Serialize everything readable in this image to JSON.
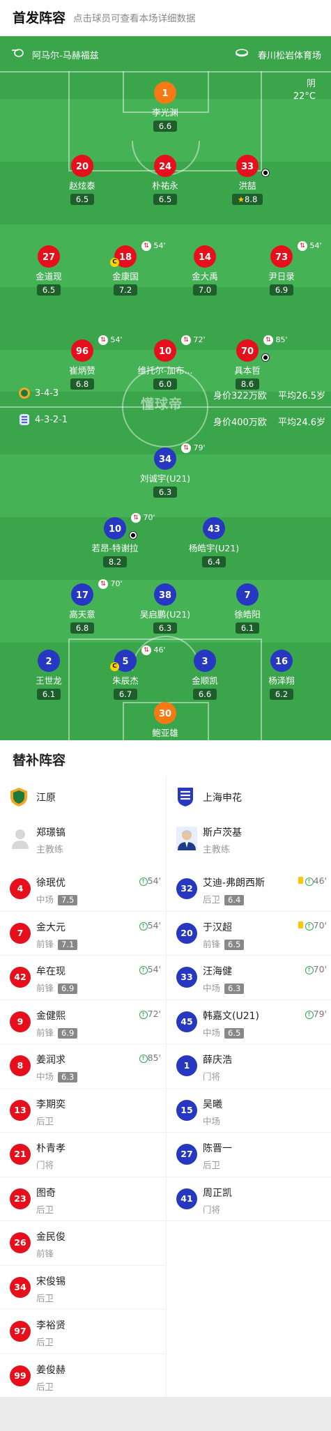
{
  "header": {
    "title": "首发阵容",
    "subtitle": "点击球员可查看本场详细数据"
  },
  "match": {
    "home_team": "阿马尔-马赫福兹",
    "venue": "春川松岩体育场",
    "weather": "阴",
    "temperature": "22°C",
    "watermark": "懂球帝"
  },
  "home_form": {
    "formation": "3-4-3",
    "value": "身价322万欧",
    "age": "平均26.5岁"
  },
  "away_form": {
    "formation": "4-3-2-1",
    "value": "身价400万欧",
    "age": "平均24.6岁"
  },
  "home_players": [
    {
      "num": "1",
      "name": "李光渊",
      "rating": "6.6",
      "color": "orange"
    },
    {
      "num": "20",
      "name": "赵炫泰",
      "rating": "6.5",
      "color": "red"
    },
    {
      "num": "24",
      "name": "朴祐永",
      "rating": "6.5",
      "color": "red"
    },
    {
      "num": "33",
      "name": "洪喆",
      "rating": "8.8",
      "color": "red",
      "star": true,
      "ball": true
    },
    {
      "num": "27",
      "name": "金道现",
      "rating": "6.5",
      "color": "red"
    },
    {
      "num": "18",
      "name": "金康国",
      "rating": "7.2",
      "color": "red",
      "sub": "54'",
      "captain": true
    },
    {
      "num": "14",
      "name": "金大禹",
      "rating": "7.0",
      "color": "red"
    },
    {
      "num": "73",
      "name": "尹日录",
      "rating": "6.9",
      "color": "red",
      "sub": "54'"
    },
    {
      "num": "96",
      "name": "崔炳赞",
      "rating": "6.8",
      "color": "red",
      "sub": "54'"
    },
    {
      "num": "10",
      "name": "维托尔-加布...",
      "rating": "6.0",
      "color": "red",
      "sub": "72'"
    },
    {
      "num": "70",
      "name": "具本哲",
      "rating": "8.6",
      "color": "red",
      "sub": "85'",
      "ball": true
    }
  ],
  "away_players": [
    {
      "num": "34",
      "name": "刘诚宇(U21)",
      "rating": "6.3",
      "color": "blue",
      "sub": "79'"
    },
    {
      "num": "10",
      "name": "若昂-特谢拉",
      "rating": "8.2",
      "color": "blue",
      "sub": "70'",
      "ball": true
    },
    {
      "num": "43",
      "name": "杨皓宇(U21)",
      "rating": "6.4",
      "color": "blue"
    },
    {
      "num": "17",
      "name": "高天意",
      "rating": "6.8",
      "color": "blue",
      "sub": "70'"
    },
    {
      "num": "38",
      "name": "吴启鹏(U21)",
      "rating": "6.3",
      "color": "blue"
    },
    {
      "num": "7",
      "name": "徐皓阳",
      "rating": "6.1",
      "color": "blue"
    },
    {
      "num": "2",
      "name": "王世龙",
      "rating": "6.1",
      "color": "blue"
    },
    {
      "num": "5",
      "name": "朱辰杰",
      "rating": "6.7",
      "color": "blue",
      "sub": "46'",
      "captain": true
    },
    {
      "num": "3",
      "name": "金顺凯",
      "rating": "6.6",
      "color": "blue"
    },
    {
      "num": "16",
      "name": "杨泽翔",
      "rating": "6.2",
      "color": "blue"
    },
    {
      "num": "30",
      "name": "鲍亚雄",
      "rating": "6.0",
      "color": "orange"
    }
  ],
  "subs": {
    "title": "替补阵容",
    "home": {
      "team": "江原",
      "coach": {
        "name": "郑璟镐",
        "role": "主教练"
      },
      "players": [
        {
          "num": "4",
          "name": "徐珉优",
          "pos": "中场",
          "rating": "7.5",
          "min": "54'"
        },
        {
          "num": "7",
          "name": "金大元",
          "pos": "前锋",
          "rating": "7.1",
          "min": "54'"
        },
        {
          "num": "42",
          "name": "牟在现",
          "pos": "前锋",
          "rating": "6.9",
          "min": "54'"
        },
        {
          "num": "9",
          "name": "金健熙",
          "pos": "前锋",
          "rating": "6.9",
          "min": "72'"
        },
        {
          "num": "8",
          "name": "姜润求",
          "pos": "中场",
          "rating": "6.3",
          "min": "85'"
        },
        {
          "num": "13",
          "name": "李期奕",
          "pos": "后卫"
        },
        {
          "num": "21",
          "name": "朴青孝",
          "pos": "门将"
        },
        {
          "num": "23",
          "name": "图奇",
          "pos": "后卫"
        },
        {
          "num": "26",
          "name": "金民俊",
          "pos": "前锋"
        },
        {
          "num": "34",
          "name": "宋俊锡",
          "pos": "后卫"
        },
        {
          "num": "97",
          "name": "李裕贤",
          "pos": "后卫"
        },
        {
          "num": "99",
          "name": "姜俊赫",
          "pos": "后卫"
        }
      ]
    },
    "away": {
      "team": "上海申花",
      "coach": {
        "name": "斯卢茨基",
        "role": "主教练"
      },
      "players": [
        {
          "num": "32",
          "name": "艾迪-弗朗西斯",
          "pos": "后卫",
          "rating": "6.4",
          "min": "46'",
          "yellow": true
        },
        {
          "num": "20",
          "name": "于汉超",
          "pos": "前锋",
          "rating": "6.5",
          "min": "70'",
          "yellow": true
        },
        {
          "num": "33",
          "name": "汪海健",
          "pos": "中场",
          "rating": "6.3",
          "min": "70'"
        },
        {
          "num": "45",
          "name": "韩嘉文(U21)",
          "pos": "中场",
          "rating": "6.5",
          "min": "79'"
        },
        {
          "num": "1",
          "name": "薛庆浩",
          "pos": "门将"
        },
        {
          "num": "15",
          "name": "吴曦",
          "pos": "中场"
        },
        {
          "num": "27",
          "name": "陈晋一",
          "pos": "后卫"
        },
        {
          "num": "41",
          "name": "周正凯",
          "pos": "门将"
        }
      ]
    }
  }
}
